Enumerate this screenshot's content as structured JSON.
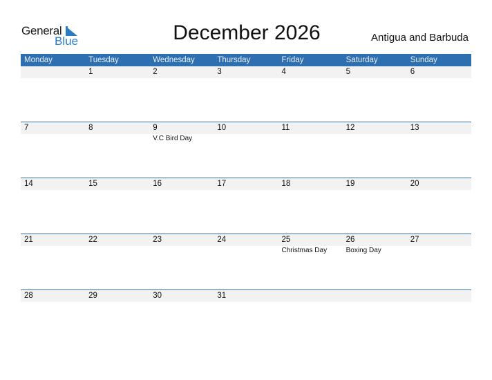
{
  "logo": {
    "line1": "General",
    "line2": "Blue",
    "accent": "#2a7bc4"
  },
  "title": "December 2026",
  "country": "Antigua and Barbuda",
  "colors": {
    "header_bg": "#2d6fb0",
    "date_band": "#f2f2f2"
  },
  "weekdays": [
    "Monday",
    "Tuesday",
    "Wednesday",
    "Thursday",
    "Friday",
    "Saturday",
    "Sunday"
  ],
  "weeks": [
    {
      "days": [
        {
          "num": "",
          "holiday": ""
        },
        {
          "num": "1",
          "holiday": ""
        },
        {
          "num": "2",
          "holiday": ""
        },
        {
          "num": "3",
          "holiday": ""
        },
        {
          "num": "4",
          "holiday": ""
        },
        {
          "num": "5",
          "holiday": ""
        },
        {
          "num": "6",
          "holiday": ""
        }
      ]
    },
    {
      "days": [
        {
          "num": "7",
          "holiday": ""
        },
        {
          "num": "8",
          "holiday": ""
        },
        {
          "num": "9",
          "holiday": "V.C Bird Day"
        },
        {
          "num": "10",
          "holiday": ""
        },
        {
          "num": "11",
          "holiday": ""
        },
        {
          "num": "12",
          "holiday": ""
        },
        {
          "num": "13",
          "holiday": ""
        }
      ]
    },
    {
      "days": [
        {
          "num": "14",
          "holiday": ""
        },
        {
          "num": "15",
          "holiday": ""
        },
        {
          "num": "16",
          "holiday": ""
        },
        {
          "num": "17",
          "holiday": ""
        },
        {
          "num": "18",
          "holiday": ""
        },
        {
          "num": "19",
          "holiday": ""
        },
        {
          "num": "20",
          "holiday": ""
        }
      ]
    },
    {
      "days": [
        {
          "num": "21",
          "holiday": ""
        },
        {
          "num": "22",
          "holiday": ""
        },
        {
          "num": "23",
          "holiday": ""
        },
        {
          "num": "24",
          "holiday": ""
        },
        {
          "num": "25",
          "holiday": "Christmas Day"
        },
        {
          "num": "26",
          "holiday": "Boxing Day"
        },
        {
          "num": "27",
          "holiday": ""
        }
      ]
    },
    {
      "days": [
        {
          "num": "28",
          "holiday": ""
        },
        {
          "num": "29",
          "holiday": ""
        },
        {
          "num": "30",
          "holiday": ""
        },
        {
          "num": "31",
          "holiday": ""
        },
        {
          "num": "",
          "holiday": ""
        },
        {
          "num": "",
          "holiday": ""
        },
        {
          "num": "",
          "holiday": ""
        }
      ]
    }
  ]
}
